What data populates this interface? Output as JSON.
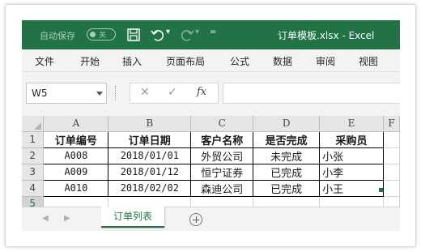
{
  "titlebar": {
    "autosave_label": "自动保存",
    "autosave_state": "关",
    "window_title": "订单模板.xlsx  -  Excel",
    "accent_color": "#217346"
  },
  "ribbon": {
    "tabs": [
      "文件",
      "开始",
      "插入",
      "页面布局",
      "公式",
      "数据",
      "审阅",
      "视图"
    ]
  },
  "formula_bar": {
    "name_box": "W5",
    "cancel_symbol": "✕",
    "enter_symbol": "✓",
    "fx_label": "fx",
    "formula_value": ""
  },
  "grid": {
    "columns": [
      "A",
      "B",
      "C",
      "D",
      "E",
      "F"
    ],
    "row_numbers": [
      "1",
      "2",
      "3",
      "4",
      "5"
    ],
    "rows": [
      [
        "订单编号",
        "订单日期",
        "客户名称",
        "是否完成",
        "采购员",
        ""
      ],
      [
        "A008",
        "2018/01/01",
        "外贸公司",
        "未完成",
        "小张",
        ""
      ],
      [
        "A009",
        "2018/01/12",
        "恒宁证券",
        "已完成",
        "小李",
        ""
      ],
      [
        "A010",
        "2018/02/02",
        "森迪公司",
        "已完成",
        "小王",
        ""
      ],
      [
        "",
        "",
        "",
        "",
        "",
        ""
      ]
    ]
  },
  "sheets": {
    "tabs": [
      "订单列表"
    ],
    "nav_prev": "◀",
    "nav_next": "▶"
  }
}
